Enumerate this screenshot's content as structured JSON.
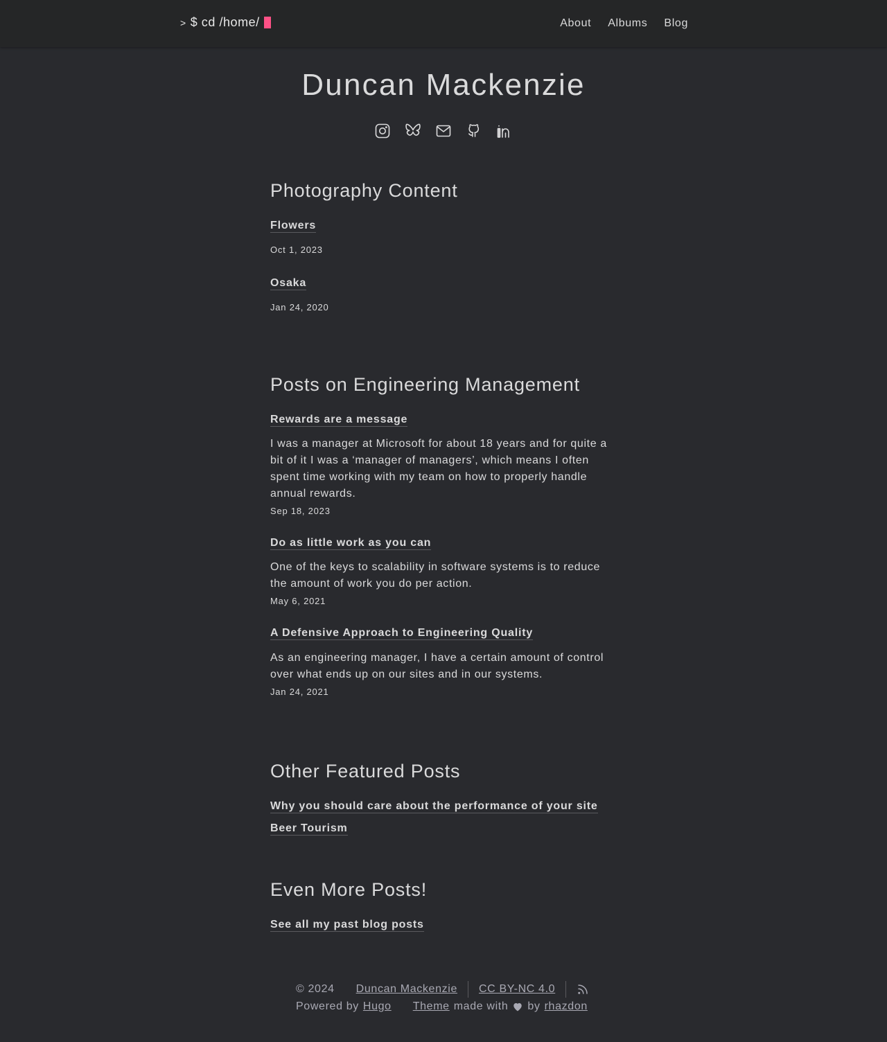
{
  "header": {
    "logo_prompt": ">",
    "logo_text": "$ cd /home/",
    "nav": [
      "About",
      "Albums",
      "Blog"
    ]
  },
  "hero": {
    "name": "Duncan Mackenzie",
    "social_icons": [
      "instagram-icon",
      "bluesky-icon",
      "mail-icon",
      "github-icon",
      "linkedin-icon"
    ]
  },
  "photography": {
    "heading": "Photography Content",
    "items": [
      {
        "title": "Flowers",
        "date": "Oct 1, 2023"
      },
      {
        "title": "Osaka",
        "date": "Jan 24, 2020"
      }
    ]
  },
  "engineering": {
    "heading": "Posts on Engineering Management",
    "items": [
      {
        "title": "Rewards are a message",
        "excerpt": "I was a manager at Microsoft for about 18 years and for quite a bit of it I was a ‘manager of managers’, which means I often spent time working with my team on how to properly handle annual rewards.",
        "date": "Sep 18, 2023"
      },
      {
        "title": "Do as little work as you can",
        "excerpt": "One of the keys to scalability in software systems is to reduce the amount of work you do per action.",
        "date": "May 6, 2021"
      },
      {
        "title": "A Defensive Approach to Engineering Quality",
        "excerpt": "As an engineering manager, I have a certain amount of control over what ends up on our sites and in our systems.",
        "date": "Jan 24, 2021"
      }
    ]
  },
  "featured": {
    "heading": "Other Featured Posts",
    "items": [
      "Why you should care about the performance of your site",
      "Beer Tourism"
    ]
  },
  "more": {
    "heading": "Even More Posts!",
    "link": "See all my past blog posts"
  },
  "footer": {
    "copyright": "© 2024",
    "author": "Duncan Mackenzie",
    "license": "CC BY-NC 4.0",
    "powered_by": "Powered by",
    "hugo": "Hugo",
    "theme": "Theme",
    "made_with": "made with",
    "by": "by",
    "rhazdon": "rhazdon"
  },
  "colors": {
    "background": "#292a2e",
    "header": "#252627",
    "accent": "#fe5186",
    "text": "#dadadb"
  }
}
